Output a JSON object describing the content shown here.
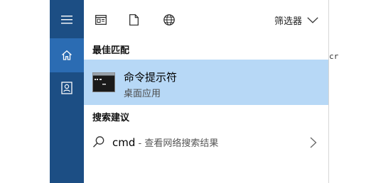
{
  "rail": {
    "items": [
      {
        "icon": "hamburger-icon"
      },
      {
        "icon": "home-icon",
        "active": true
      },
      {
        "icon": "contact-card-icon"
      }
    ]
  },
  "toolbar": {
    "icons": [
      "app-window-icon",
      "document-icon",
      "globe-icon"
    ],
    "filter_label": "筛选器"
  },
  "best_match": {
    "heading": "最佳匹配",
    "title": "命令提示符",
    "subtitle": "桌面应用"
  },
  "suggestions": {
    "heading": "搜索建议",
    "query": "cmd",
    "hint": " - 查看网络搜索结果"
  },
  "edge_text": "cr",
  "colors": {
    "rail": "#1c4e84",
    "rail_active": "#2b6cb3",
    "selected_row": "#b7d8f6"
  }
}
